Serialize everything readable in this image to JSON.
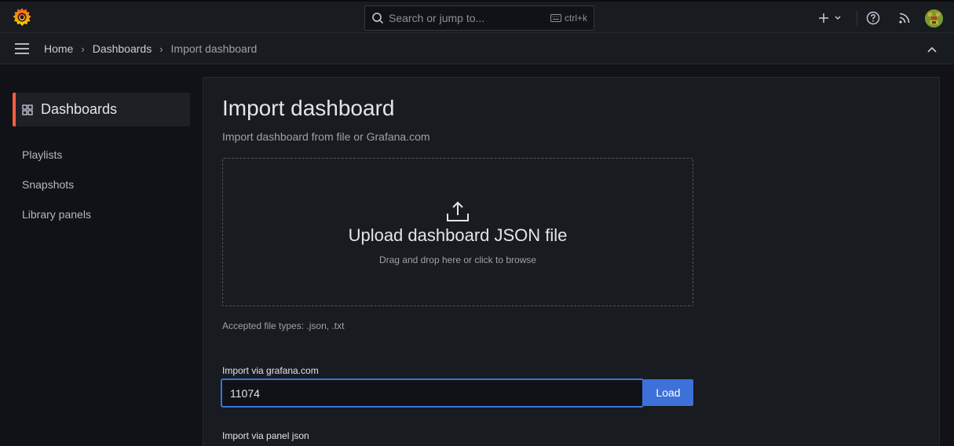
{
  "topbar": {
    "search": {
      "placeholder": "Search or jump to...",
      "shortcut": "ctrl+k"
    }
  },
  "breadcrumb": {
    "items": [
      "Home",
      "Dashboards",
      "Import dashboard"
    ]
  },
  "sidebar": {
    "active": {
      "label": "Dashboards",
      "icon": "apps-icon"
    },
    "items": [
      {
        "label": "Playlists"
      },
      {
        "label": "Snapshots"
      },
      {
        "label": "Library panels"
      }
    ]
  },
  "main": {
    "title": "Import dashboard",
    "subtitle": "Import dashboard from file or Grafana.com",
    "upload": {
      "title": "Upload dashboard JSON file",
      "hint": "Drag and drop here or click to browse"
    },
    "accepted_types": "Accepted file types: .json, .txt",
    "grafana_com": {
      "label": "Import via grafana.com",
      "value": "11074",
      "button": "Load"
    },
    "panel_json": {
      "label": "Import via panel json"
    }
  },
  "colors": {
    "accent": "#f55f3e",
    "primary": "#3d71d9",
    "background": "#111217",
    "panel": "#181b1f"
  }
}
